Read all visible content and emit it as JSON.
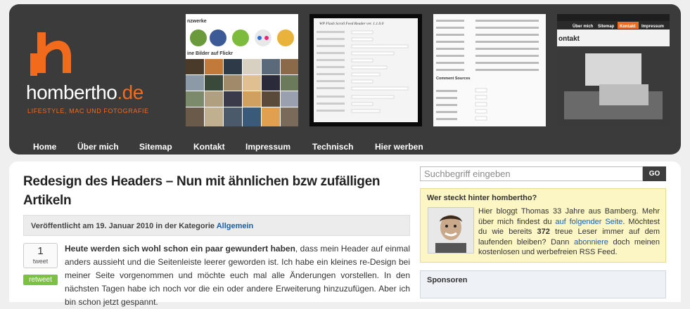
{
  "header": {
    "site_name": "hombertho",
    "site_tld": ".de",
    "tagline": "LIFESTYLE, MAC UND FOTOGRAFIE",
    "brand_color": "#f26b1d",
    "thumbs": {
      "flickr_heading_1": "nzwerke",
      "flickr_heading_2": "ine Bilder auf Flickr",
      "plugin_title": "WP Flash Scroll Feed Reader ver. 1.1.0.0",
      "comment_sources": "Comment Sources",
      "kontakt_label": "ontakt",
      "nav_items": [
        "Über mich",
        "Sitemap",
        "Kontakt",
        "Impressum"
      ]
    }
  },
  "nav": {
    "items": [
      "Home",
      "Über mich",
      "Sitemap",
      "Kontakt",
      "Impressum",
      "Technisch",
      "Hier werben"
    ]
  },
  "post": {
    "title": "Redesign des Headers – Nun mit ähnlichen bzw zufälligen Artikeln",
    "meta_prefix": "Veröffentlicht am 19. Januar 2010 in der Kategorie",
    "meta_category": "Allgemein",
    "tweet_count": "1",
    "tweet_label": "tweet",
    "retweet_label": "retweet",
    "body_lead": "Heute werden sich wohl schon ein paar gewundert haben",
    "body_rest": ", dass mein Header auf einmal anders aussieht und die Seitenleiste leerer geworden ist. Ich habe ein kleines re-Design bei meiner Seite vorgenommen und möchte euch mal alle Änderungen vorstellen. In den nächsten Tagen habe ich noch vor die ein oder andere Erweiterung hinzuzufügen. Aber ich bin schon jetzt gespannt."
  },
  "sidebar": {
    "search": {
      "placeholder": "Suchbegriff eingeben",
      "button": "GO"
    },
    "about": {
      "title": "Wer steckt hinter hombertho?",
      "text_1": "Hier bloggt Thomas 33 Jahre aus Bamberg. Mehr über mich findest du ",
      "link_1": "auf folgender Seite",
      "text_2": ". Möchtest du wie bereits ",
      "reader_count": "372",
      "text_3": " treue Leser immer auf dem laufenden bleiben? Dann ",
      "link_2": "abonniere",
      "text_4": " doch meinen kostenlosen und werbefreien RSS Feed."
    },
    "sponsors": {
      "title": "Sponsoren"
    }
  }
}
